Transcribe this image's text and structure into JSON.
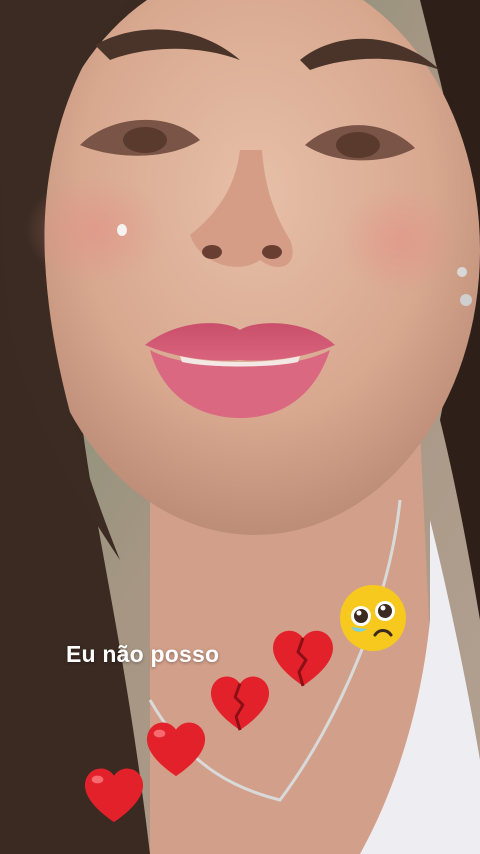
{
  "story": {
    "caption": "Eu não posso",
    "stickers": [
      {
        "icon": "pleading-face-emoji-icon"
      },
      {
        "icon": "broken-heart-icon"
      },
      {
        "icon": "broken-heart-icon"
      },
      {
        "icon": "red-heart-icon"
      },
      {
        "icon": "red-heart-icon"
      }
    ]
  },
  "colors": {
    "heart": "#e3212b",
    "emoji_yellow": "#f7c81e",
    "caption_text": "#ffffff"
  }
}
